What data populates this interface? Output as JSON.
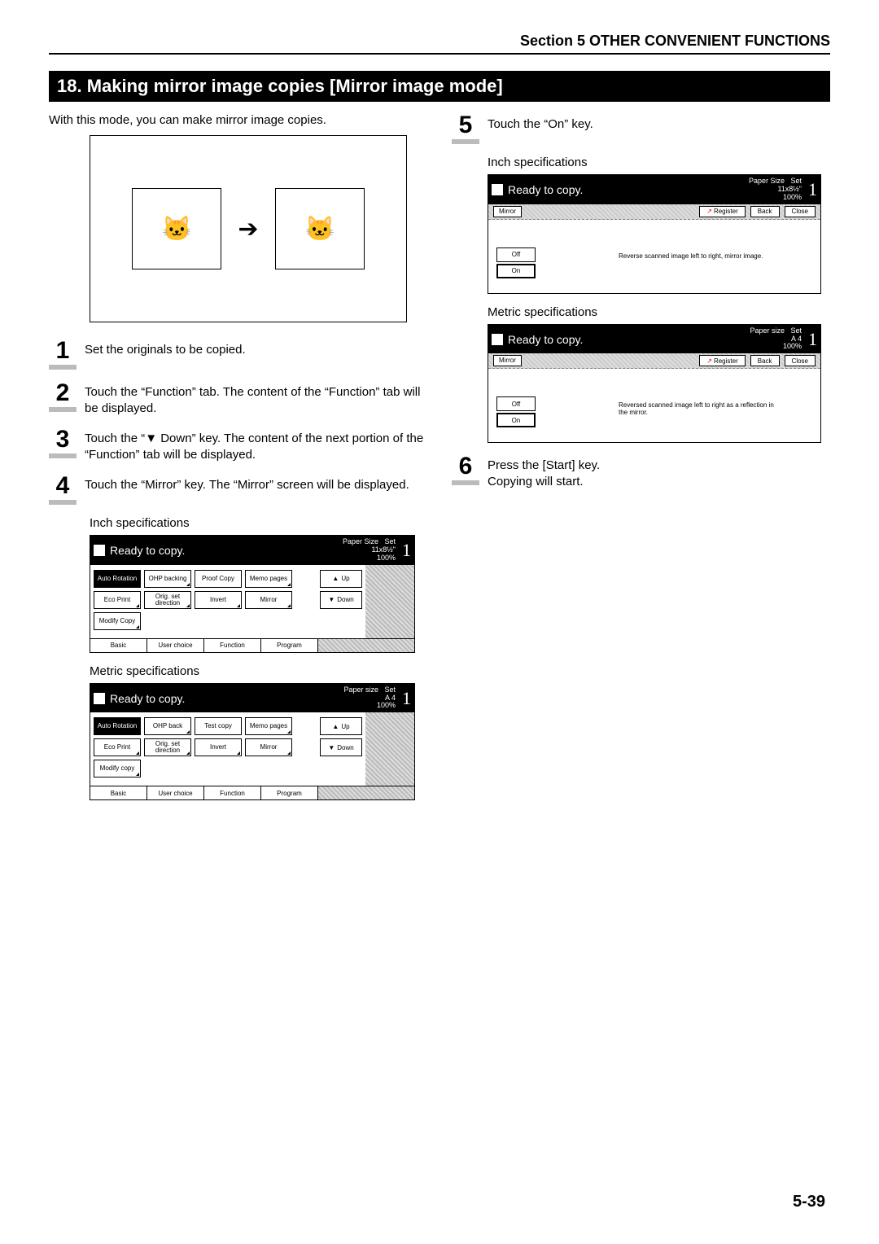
{
  "section_header": "Section 5  OTHER CONVENIENT FUNCTIONS",
  "title": "18. Making mirror image copies [Mirror image mode]",
  "intro": "With this mode, you can make mirror image copies.",
  "steps": {
    "1": "Set the originals to be copied.",
    "2": "Touch the “Function” tab. The content of the “Function” tab will be displayed.",
    "3": "Touch the “▼ Down” key. The content of the next portion of the “Function” tab will be displayed.",
    "4": "Touch the “Mirror” key. The “Mirror” screen will be displayed.",
    "5": "Touch the “On” key.",
    "6a": "Press the [Start] key.",
    "6b": "Copying will start."
  },
  "labels": {
    "inch_spec": "Inch specifications",
    "metric_spec": "Metric specifications"
  },
  "panel_common": {
    "ready": "Ready to copy.",
    "paper_size_label_inch": "Paper Size",
    "paper_size_label_metric": "Paper size",
    "paper_size_inch": "11x8½\"",
    "paper_size_metric": "A 4",
    "zoom": "100%",
    "set": "Set",
    "count": "1"
  },
  "func_inch": {
    "auto_rotation": "Auto Rotation",
    "ohp_backing": "OHP backing",
    "proof_copy": "Proof Copy",
    "memo_pages": "Memo pages",
    "eco_print": "Eco Print",
    "orig_set_dir": "Orig. set direction",
    "invert": "Invert",
    "mirror": "Mirror",
    "modify_copy": "Modify Copy",
    "up": "Up",
    "down": "Down",
    "tabs": {
      "basic": "Basic",
      "user_choice": "User choice",
      "function": "Function",
      "program": "Program"
    }
  },
  "func_metric": {
    "auto_rotation": "Auto Rotation",
    "ohp_back": "OHP back",
    "test_copy": "Test copy",
    "memo_pages": "Memo pages",
    "eco_print": "Eco Print",
    "orig_set_dir": "Orig. set direction",
    "invert": "Invert",
    "mirror": "Mirror",
    "modify_copy": "Modify copy",
    "up": "Up",
    "down": "Down",
    "tabs": {
      "basic": "Basic",
      "user_choice": "User choice",
      "function": "Function",
      "program": "Program"
    }
  },
  "mirror_inch": {
    "mirror": "Mirror",
    "register": "Register",
    "back": "Back",
    "close": "Close",
    "off": "Off",
    "on": "On",
    "help": "Reverse scanned image left to right, mirror image."
  },
  "mirror_metric": {
    "mirror": "Mirror",
    "register": "Register",
    "back": "Back",
    "close": "Close",
    "off": "Off",
    "on": "On",
    "help": "Reversed scanned image left to right as a reflection in the mirror."
  },
  "page_number": "5-39"
}
